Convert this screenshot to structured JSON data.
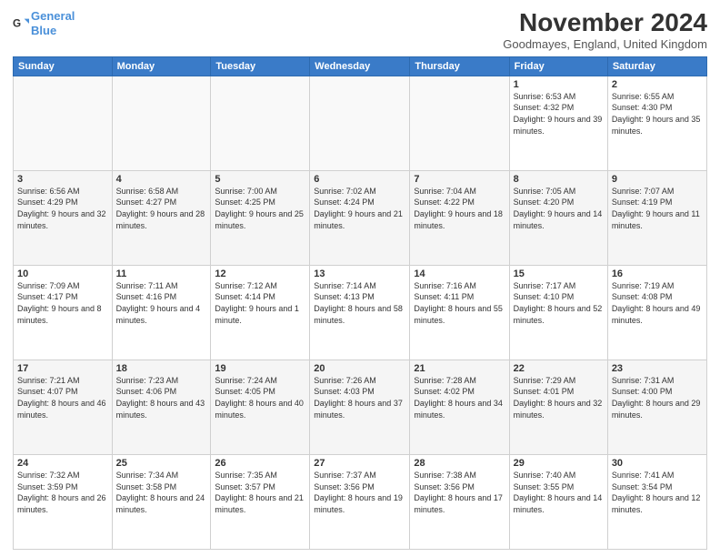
{
  "logo": {
    "line1": "General",
    "line2": "Blue"
  },
  "title": "November 2024",
  "location": "Goodmayes, England, United Kingdom",
  "headers": [
    "Sunday",
    "Monday",
    "Tuesday",
    "Wednesday",
    "Thursday",
    "Friday",
    "Saturday"
  ],
  "weeks": [
    [
      {
        "day": "",
        "text": ""
      },
      {
        "day": "",
        "text": ""
      },
      {
        "day": "",
        "text": ""
      },
      {
        "day": "",
        "text": ""
      },
      {
        "day": "",
        "text": ""
      },
      {
        "day": "1",
        "text": "Sunrise: 6:53 AM\nSunset: 4:32 PM\nDaylight: 9 hours and 39 minutes."
      },
      {
        "day": "2",
        "text": "Sunrise: 6:55 AM\nSunset: 4:30 PM\nDaylight: 9 hours and 35 minutes."
      }
    ],
    [
      {
        "day": "3",
        "text": "Sunrise: 6:56 AM\nSunset: 4:29 PM\nDaylight: 9 hours and 32 minutes."
      },
      {
        "day": "4",
        "text": "Sunrise: 6:58 AM\nSunset: 4:27 PM\nDaylight: 9 hours and 28 minutes."
      },
      {
        "day": "5",
        "text": "Sunrise: 7:00 AM\nSunset: 4:25 PM\nDaylight: 9 hours and 25 minutes."
      },
      {
        "day": "6",
        "text": "Sunrise: 7:02 AM\nSunset: 4:24 PM\nDaylight: 9 hours and 21 minutes."
      },
      {
        "day": "7",
        "text": "Sunrise: 7:04 AM\nSunset: 4:22 PM\nDaylight: 9 hours and 18 minutes."
      },
      {
        "day": "8",
        "text": "Sunrise: 7:05 AM\nSunset: 4:20 PM\nDaylight: 9 hours and 14 minutes."
      },
      {
        "day": "9",
        "text": "Sunrise: 7:07 AM\nSunset: 4:19 PM\nDaylight: 9 hours and 11 minutes."
      }
    ],
    [
      {
        "day": "10",
        "text": "Sunrise: 7:09 AM\nSunset: 4:17 PM\nDaylight: 9 hours and 8 minutes."
      },
      {
        "day": "11",
        "text": "Sunrise: 7:11 AM\nSunset: 4:16 PM\nDaylight: 9 hours and 4 minutes."
      },
      {
        "day": "12",
        "text": "Sunrise: 7:12 AM\nSunset: 4:14 PM\nDaylight: 9 hours and 1 minute."
      },
      {
        "day": "13",
        "text": "Sunrise: 7:14 AM\nSunset: 4:13 PM\nDaylight: 8 hours and 58 minutes."
      },
      {
        "day": "14",
        "text": "Sunrise: 7:16 AM\nSunset: 4:11 PM\nDaylight: 8 hours and 55 minutes."
      },
      {
        "day": "15",
        "text": "Sunrise: 7:17 AM\nSunset: 4:10 PM\nDaylight: 8 hours and 52 minutes."
      },
      {
        "day": "16",
        "text": "Sunrise: 7:19 AM\nSunset: 4:08 PM\nDaylight: 8 hours and 49 minutes."
      }
    ],
    [
      {
        "day": "17",
        "text": "Sunrise: 7:21 AM\nSunset: 4:07 PM\nDaylight: 8 hours and 46 minutes."
      },
      {
        "day": "18",
        "text": "Sunrise: 7:23 AM\nSunset: 4:06 PM\nDaylight: 8 hours and 43 minutes."
      },
      {
        "day": "19",
        "text": "Sunrise: 7:24 AM\nSunset: 4:05 PM\nDaylight: 8 hours and 40 minutes."
      },
      {
        "day": "20",
        "text": "Sunrise: 7:26 AM\nSunset: 4:03 PM\nDaylight: 8 hours and 37 minutes."
      },
      {
        "day": "21",
        "text": "Sunrise: 7:28 AM\nSunset: 4:02 PM\nDaylight: 8 hours and 34 minutes."
      },
      {
        "day": "22",
        "text": "Sunrise: 7:29 AM\nSunset: 4:01 PM\nDaylight: 8 hours and 32 minutes."
      },
      {
        "day": "23",
        "text": "Sunrise: 7:31 AM\nSunset: 4:00 PM\nDaylight: 8 hours and 29 minutes."
      }
    ],
    [
      {
        "day": "24",
        "text": "Sunrise: 7:32 AM\nSunset: 3:59 PM\nDaylight: 8 hours and 26 minutes."
      },
      {
        "day": "25",
        "text": "Sunrise: 7:34 AM\nSunset: 3:58 PM\nDaylight: 8 hours and 24 minutes."
      },
      {
        "day": "26",
        "text": "Sunrise: 7:35 AM\nSunset: 3:57 PM\nDaylight: 8 hours and 21 minutes."
      },
      {
        "day": "27",
        "text": "Sunrise: 7:37 AM\nSunset: 3:56 PM\nDaylight: 8 hours and 19 minutes."
      },
      {
        "day": "28",
        "text": "Sunrise: 7:38 AM\nSunset: 3:56 PM\nDaylight: 8 hours and 17 minutes."
      },
      {
        "day": "29",
        "text": "Sunrise: 7:40 AM\nSunset: 3:55 PM\nDaylight: 8 hours and 14 minutes."
      },
      {
        "day": "30",
        "text": "Sunrise: 7:41 AM\nSunset: 3:54 PM\nDaylight: 8 hours and 12 minutes."
      }
    ]
  ]
}
